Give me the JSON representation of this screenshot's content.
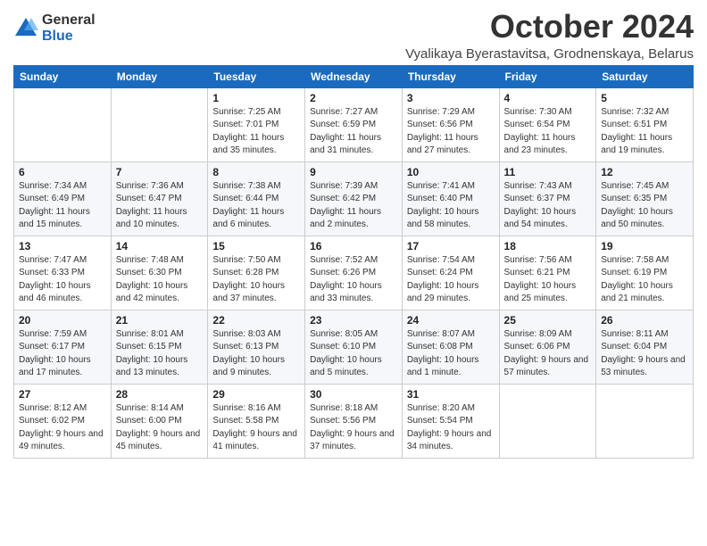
{
  "header": {
    "logo_general": "General",
    "logo_blue": "Blue",
    "title": "October 2024",
    "location": "Vyalikaya Byerastavitsa, Grodnenskaya, Belarus"
  },
  "columns": [
    "Sunday",
    "Monday",
    "Tuesday",
    "Wednesday",
    "Thursday",
    "Friday",
    "Saturday"
  ],
  "weeks": [
    [
      {
        "day": "",
        "info": ""
      },
      {
        "day": "",
        "info": ""
      },
      {
        "day": "1",
        "info": "Sunrise: 7:25 AM\nSunset: 7:01 PM\nDaylight: 11 hours and 35 minutes."
      },
      {
        "day": "2",
        "info": "Sunrise: 7:27 AM\nSunset: 6:59 PM\nDaylight: 11 hours and 31 minutes."
      },
      {
        "day": "3",
        "info": "Sunrise: 7:29 AM\nSunset: 6:56 PM\nDaylight: 11 hours and 27 minutes."
      },
      {
        "day": "4",
        "info": "Sunrise: 7:30 AM\nSunset: 6:54 PM\nDaylight: 11 hours and 23 minutes."
      },
      {
        "day": "5",
        "info": "Sunrise: 7:32 AM\nSunset: 6:51 PM\nDaylight: 11 hours and 19 minutes."
      }
    ],
    [
      {
        "day": "6",
        "info": "Sunrise: 7:34 AM\nSunset: 6:49 PM\nDaylight: 11 hours and 15 minutes."
      },
      {
        "day": "7",
        "info": "Sunrise: 7:36 AM\nSunset: 6:47 PM\nDaylight: 11 hours and 10 minutes."
      },
      {
        "day": "8",
        "info": "Sunrise: 7:38 AM\nSunset: 6:44 PM\nDaylight: 11 hours and 6 minutes."
      },
      {
        "day": "9",
        "info": "Sunrise: 7:39 AM\nSunset: 6:42 PM\nDaylight: 11 hours and 2 minutes."
      },
      {
        "day": "10",
        "info": "Sunrise: 7:41 AM\nSunset: 6:40 PM\nDaylight: 10 hours and 58 minutes."
      },
      {
        "day": "11",
        "info": "Sunrise: 7:43 AM\nSunset: 6:37 PM\nDaylight: 10 hours and 54 minutes."
      },
      {
        "day": "12",
        "info": "Sunrise: 7:45 AM\nSunset: 6:35 PM\nDaylight: 10 hours and 50 minutes."
      }
    ],
    [
      {
        "day": "13",
        "info": "Sunrise: 7:47 AM\nSunset: 6:33 PM\nDaylight: 10 hours and 46 minutes."
      },
      {
        "day": "14",
        "info": "Sunrise: 7:48 AM\nSunset: 6:30 PM\nDaylight: 10 hours and 42 minutes."
      },
      {
        "day": "15",
        "info": "Sunrise: 7:50 AM\nSunset: 6:28 PM\nDaylight: 10 hours and 37 minutes."
      },
      {
        "day": "16",
        "info": "Sunrise: 7:52 AM\nSunset: 6:26 PM\nDaylight: 10 hours and 33 minutes."
      },
      {
        "day": "17",
        "info": "Sunrise: 7:54 AM\nSunset: 6:24 PM\nDaylight: 10 hours and 29 minutes."
      },
      {
        "day": "18",
        "info": "Sunrise: 7:56 AM\nSunset: 6:21 PM\nDaylight: 10 hours and 25 minutes."
      },
      {
        "day": "19",
        "info": "Sunrise: 7:58 AM\nSunset: 6:19 PM\nDaylight: 10 hours and 21 minutes."
      }
    ],
    [
      {
        "day": "20",
        "info": "Sunrise: 7:59 AM\nSunset: 6:17 PM\nDaylight: 10 hours and 17 minutes."
      },
      {
        "day": "21",
        "info": "Sunrise: 8:01 AM\nSunset: 6:15 PM\nDaylight: 10 hours and 13 minutes."
      },
      {
        "day": "22",
        "info": "Sunrise: 8:03 AM\nSunset: 6:13 PM\nDaylight: 10 hours and 9 minutes."
      },
      {
        "day": "23",
        "info": "Sunrise: 8:05 AM\nSunset: 6:10 PM\nDaylight: 10 hours and 5 minutes."
      },
      {
        "day": "24",
        "info": "Sunrise: 8:07 AM\nSunset: 6:08 PM\nDaylight: 10 hours and 1 minute."
      },
      {
        "day": "25",
        "info": "Sunrise: 8:09 AM\nSunset: 6:06 PM\nDaylight: 9 hours and 57 minutes."
      },
      {
        "day": "26",
        "info": "Sunrise: 8:11 AM\nSunset: 6:04 PM\nDaylight: 9 hours and 53 minutes."
      }
    ],
    [
      {
        "day": "27",
        "info": "Sunrise: 8:12 AM\nSunset: 6:02 PM\nDaylight: 9 hours and 49 minutes."
      },
      {
        "day": "28",
        "info": "Sunrise: 8:14 AM\nSunset: 6:00 PM\nDaylight: 9 hours and 45 minutes."
      },
      {
        "day": "29",
        "info": "Sunrise: 8:16 AM\nSunset: 5:58 PM\nDaylight: 9 hours and 41 minutes."
      },
      {
        "day": "30",
        "info": "Sunrise: 8:18 AM\nSunset: 5:56 PM\nDaylight: 9 hours and 37 minutes."
      },
      {
        "day": "31",
        "info": "Sunrise: 8:20 AM\nSunset: 5:54 PM\nDaylight: 9 hours and 34 minutes."
      },
      {
        "day": "",
        "info": ""
      },
      {
        "day": "",
        "info": ""
      }
    ]
  ]
}
